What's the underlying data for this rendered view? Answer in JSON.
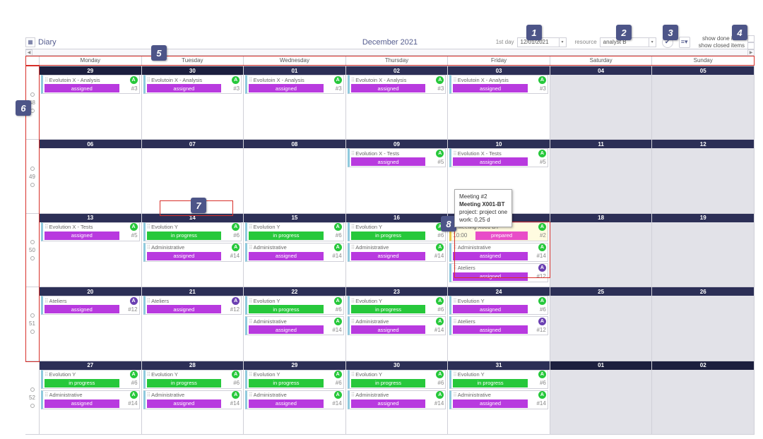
{
  "top": {
    "title": "Diary",
    "month": "December 2021",
    "firstDayLabel": "1st day",
    "firstDayValue": "12/01/2021",
    "resourceLabel": "resource",
    "resourceValue": "analyst B",
    "showDone": "show done items",
    "showClosed": "show closed items"
  },
  "dayNames": [
    "Monday",
    "Tuesday",
    "Wednesday",
    "Thursday",
    "Friday",
    "Saturday",
    "Sunday"
  ],
  "weekNumbers": [
    "48",
    "49",
    "50",
    "51",
    "52"
  ],
  "rows": [
    {
      "dates": [
        "29",
        "30",
        "01",
        "02",
        "03",
        "04",
        "05"
      ],
      "offDays": [
        0,
        1
      ],
      "weekend": [
        5,
        6
      ]
    },
    {
      "dates": [
        "06",
        "07",
        "08",
        "09",
        "10",
        "11",
        "12"
      ],
      "offDays": [],
      "weekend": [
        5,
        6
      ]
    },
    {
      "dates": [
        "13",
        "14",
        "15",
        "16",
        "17",
        "18",
        "19"
      ],
      "offDays": [],
      "weekend": [
        5,
        6
      ]
    },
    {
      "dates": [
        "20",
        "21",
        "22",
        "23",
        "24",
        "25",
        "26"
      ],
      "offDays": [],
      "weekend": [
        5,
        6
      ]
    },
    {
      "dates": [
        "27",
        "28",
        "29",
        "30",
        "31",
        "01",
        "02"
      ],
      "offDays": [
        5,
        6
      ],
      "weekend": [
        5,
        6
      ]
    }
  ],
  "statusLabels": {
    "assigned": "assigned",
    "progress": "in progress",
    "prepared": "prepared"
  },
  "taskNames": {
    "evoAnalysis": "Evolutoin X - Analysis",
    "evoTests": "Evolution X - Tests",
    "evoY": "Evolution Y",
    "admin": "Administrative",
    "ateliers": "Ateliers",
    "meeting": "Meeting X001-BT"
  },
  "events": {
    "0-0": [
      {
        "t": "evoAnalysis",
        "s": "assigned",
        "b": "g",
        "n": "#3"
      }
    ],
    "0-1": [
      {
        "t": "evoAnalysis",
        "s": "assigned",
        "b": "g",
        "n": "#3"
      }
    ],
    "0-2": [
      {
        "t": "evoAnalysis",
        "s": "assigned",
        "b": "g",
        "n": "#3"
      }
    ],
    "0-3": [
      {
        "t": "evoAnalysis",
        "s": "assigned",
        "b": "g",
        "n": "#3"
      }
    ],
    "0-4": [
      {
        "t": "evoAnalysis",
        "s": "assigned",
        "b": "g",
        "n": "#3"
      }
    ],
    "1-3": [
      {
        "t": "evoTests",
        "s": "assigned",
        "b": "g",
        "n": "#5"
      }
    ],
    "1-4": [
      {
        "t": "evoTests",
        "s": "assigned",
        "b": "g",
        "n": "#5"
      }
    ],
    "2-0": [
      {
        "t": "evoTests",
        "s": "assigned",
        "b": "g",
        "n": "#5"
      }
    ],
    "2-1": [
      {
        "t": "evoY",
        "s": "progress",
        "b": "g",
        "n": "#6"
      },
      {
        "t": "admin",
        "s": "assigned",
        "b": "g",
        "n": "#14"
      }
    ],
    "2-2": [
      {
        "t": "evoY",
        "s": "progress",
        "b": "g",
        "n": "#6"
      },
      {
        "t": "admin",
        "s": "assigned",
        "b": "g",
        "n": "#14"
      }
    ],
    "2-3": [
      {
        "t": "evoY",
        "s": "progress",
        "b": "g",
        "n": "#6"
      },
      {
        "t": "admin",
        "s": "assigned",
        "b": "g",
        "n": "#14"
      }
    ],
    "2-4": [
      {
        "t": "meeting",
        "s": "prepared",
        "b": "g",
        "n": "#2",
        "meeting": true,
        "time": "10:00"
      },
      {
        "t": "admin",
        "s": "assigned",
        "b": "g",
        "n": "#14"
      },
      {
        "t": "ateliers",
        "s": "assigned",
        "b": "p",
        "n": "#12"
      }
    ],
    "3-0": [
      {
        "t": "ateliers",
        "s": "assigned",
        "b": "p",
        "n": "#12"
      }
    ],
    "3-1": [
      {
        "t": "ateliers",
        "s": "assigned",
        "b": "p",
        "n": "#12"
      }
    ],
    "3-2": [
      {
        "t": "evoY",
        "s": "progress",
        "b": "g",
        "n": "#6"
      },
      {
        "t": "admin",
        "s": "assigned",
        "b": "g",
        "n": "#14"
      }
    ],
    "3-3": [
      {
        "t": "evoY",
        "s": "progress",
        "b": "g",
        "n": "#6"
      },
      {
        "t": "admin",
        "s": "assigned",
        "b": "g",
        "n": "#14"
      }
    ],
    "3-4": [
      {
        "t": "evoY",
        "s": "assigned",
        "b": "g",
        "n": "#6"
      },
      {
        "t": "ateliers",
        "s": "assigned",
        "b": "p",
        "n": "#12"
      }
    ],
    "4-0": [
      {
        "t": "evoY",
        "s": "progress",
        "b": "g",
        "n": "#6"
      },
      {
        "t": "admin",
        "s": "assigned",
        "b": "g",
        "n": "#14"
      }
    ],
    "4-1": [
      {
        "t": "evoY",
        "s": "progress",
        "b": "g",
        "n": "#6"
      },
      {
        "t": "admin",
        "s": "assigned",
        "b": "g",
        "n": "#14"
      }
    ],
    "4-2": [
      {
        "t": "evoY",
        "s": "progress",
        "b": "g",
        "n": "#6"
      },
      {
        "t": "admin",
        "s": "assigned",
        "b": "g",
        "n": "#14"
      }
    ],
    "4-3": [
      {
        "t": "evoY",
        "s": "progress",
        "b": "g",
        "n": "#6"
      },
      {
        "t": "admin",
        "s": "assigned",
        "b": "g",
        "n": "#14"
      }
    ],
    "4-4": [
      {
        "t": "evoY",
        "s": "progress",
        "b": "g",
        "n": "#6"
      },
      {
        "t": "admin",
        "s": "assigned",
        "b": "g",
        "n": "#14"
      }
    ]
  },
  "tooltip": {
    "line1": "Meeting #2",
    "line2": "Meeting X001-BT",
    "line3": "project: project one",
    "line4": "work: 0,25 d"
  },
  "callouts": [
    "1",
    "2",
    "3",
    "4",
    "5",
    "6",
    "7",
    "8"
  ]
}
